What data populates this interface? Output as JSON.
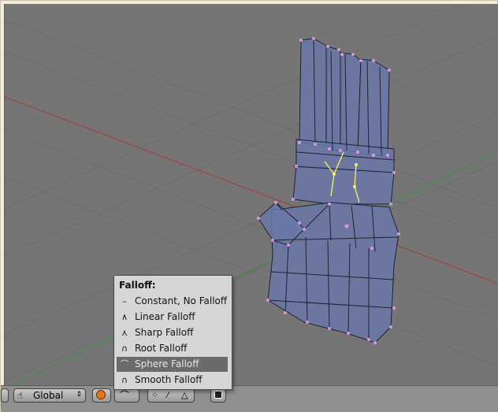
{
  "falloff_menu": {
    "title": "Falloff:",
    "items": [
      {
        "label": "Constant, No Falloff",
        "icon": "constant-falloff-icon",
        "glyph": "–"
      },
      {
        "label": "Linear Falloff",
        "icon": "linear-falloff-icon",
        "glyph": "∧"
      },
      {
        "label": "Sharp Falloff",
        "icon": "sharp-falloff-icon",
        "glyph": "⋏"
      },
      {
        "label": "Root Falloff",
        "icon": "root-falloff-icon",
        "glyph": "∩"
      },
      {
        "label": "Sphere Falloff",
        "icon": "sphere-falloff-icon",
        "glyph": "⌒",
        "selected": true
      },
      {
        "label": "Smooth Falloff",
        "icon": "smooth-falloff-icon",
        "glyph": "∩"
      }
    ]
  },
  "header": {
    "transform_orientation": "Global"
  },
  "colors": {
    "viewport_bg": "#757575",
    "mesh_fill": "#6a78a8",
    "vertex": "#f0a0f0",
    "selected_edge": "#ffff60",
    "x_axis": "#a23a3a",
    "y_axis": "#3f8f3f",
    "menu_highlight": "#6b6b6b"
  }
}
